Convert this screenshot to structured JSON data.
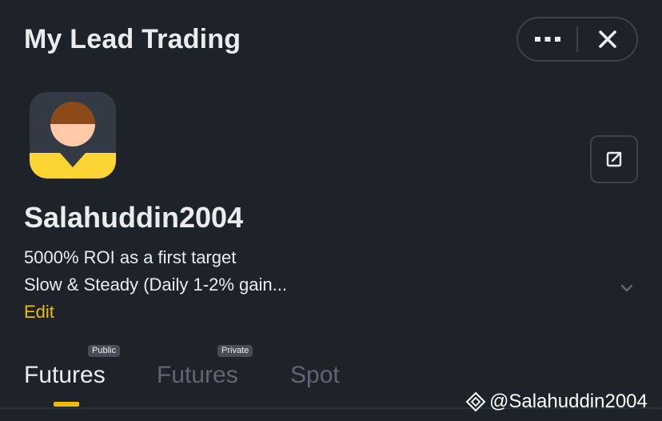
{
  "header": {
    "title": "My Lead Trading",
    "more_icon": "more-dots-icon",
    "close_icon": "close-icon"
  },
  "profile": {
    "avatar_icon": "user-avatar-icon",
    "edit_icon": "edit-share-icon",
    "username": "Salahuddin2004",
    "bio_line1": "5000% ROI as a first target",
    "bio_line2": "Slow & Steady (Daily 1-2% gain...",
    "expand_icon": "chevron-down-icon",
    "edit_label": "Edit"
  },
  "tabs": [
    {
      "label": "Futures",
      "badge": "Public",
      "active": true
    },
    {
      "label": "Futures",
      "badge": "Private",
      "active": false
    },
    {
      "label": "Spot",
      "badge": "",
      "active": false
    }
  ],
  "watermark": {
    "text": "@Salahuddin2004",
    "logo_icon": "binance-logo-icon"
  },
  "colors": {
    "background": "#1e2329",
    "accent": "#f0b90b",
    "text_primary": "#eaecef",
    "text_muted": "#5e6673",
    "border": "#3c434d"
  }
}
